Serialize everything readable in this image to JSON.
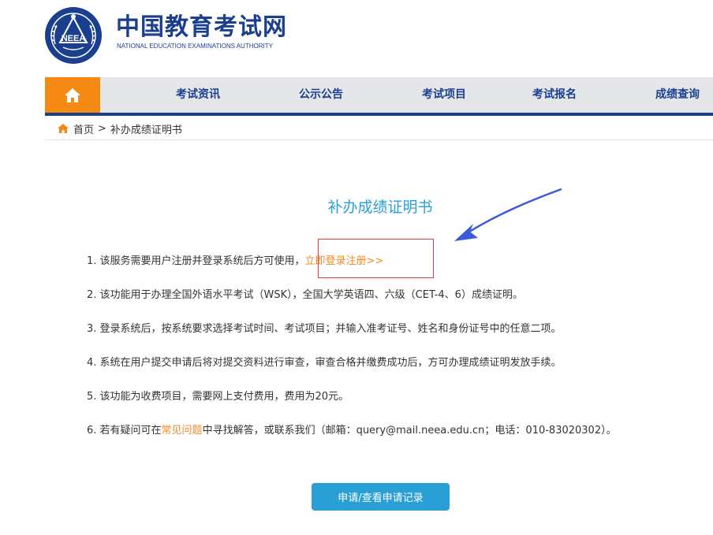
{
  "header": {
    "title": "中国教育考试网",
    "subtitle": "NATIONAL EDUCATION EXAMINATIONS AUTHORITY",
    "emblem_text": "NEEA"
  },
  "nav": {
    "home_icon": "home-icon",
    "items": [
      {
        "label": "考试资讯"
      },
      {
        "label": "公示公告"
      },
      {
        "label": "考试项目"
      },
      {
        "label": "考试报名"
      },
      {
        "label": "成绩查询"
      }
    ]
  },
  "breadcrumb": {
    "home": "首页",
    "separator": ">",
    "current": "补办成绩证明书"
  },
  "content": {
    "title": "补办成绩证明书",
    "items": [
      {
        "prefix": "1. 该服务需要用户注册并登录系统后方可使用，",
        "link": "立即登录注册>>",
        "suffix": ""
      },
      {
        "text": "2. 该功能用于办理全国外语水平考试（WSK），全国大学英语四、六级（CET-4、6）成绩证明。"
      },
      {
        "text": "3. 登录系统后，按系统要求选择考试时间、考试项目；并输入准考证号、姓名和身份证号中的任意二项。"
      },
      {
        "text": "4. 系统在用户提交申请后将对提交资料进行审查，审查合格并缴费成功后，方可办理成绩证明发放手续。"
      },
      {
        "text": "5. 该功能为收费项目，需要网上支付费用，费用为20元。"
      },
      {
        "prefix": "6. 若有疑问可在",
        "link": "常见问题",
        "suffix": "中寻找解答，或联系我们（邮箱：query@mail.neea.edu.cn；电话：010-83020302）。"
      }
    ],
    "button_label": "申请/查看申请记录"
  },
  "colors": {
    "brand_blue": "#1b3f8f",
    "accent_orange": "#f48a12",
    "link_orange": "#f08a24",
    "title_blue": "#2a9fd6",
    "annotation_red": "#e43a3a",
    "arrow_blue": "#3b5bdb"
  }
}
